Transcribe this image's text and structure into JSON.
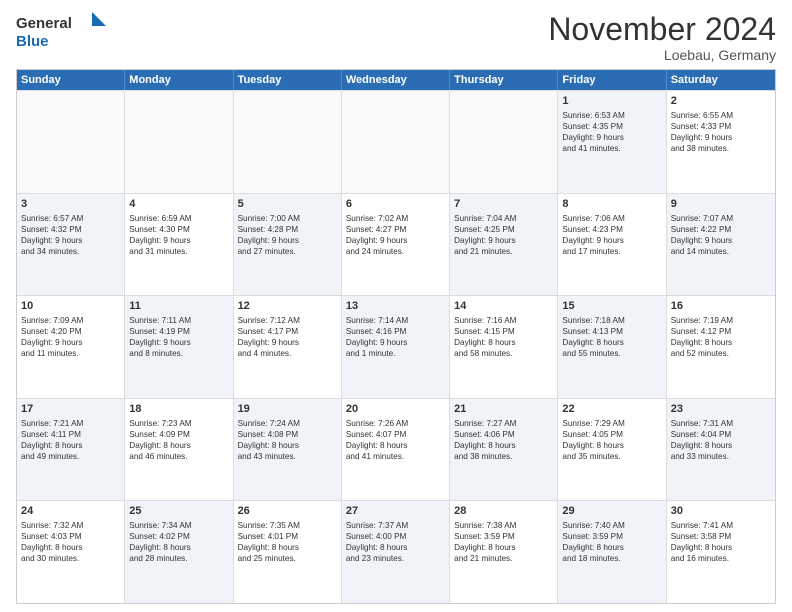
{
  "logo": {
    "line1": "General",
    "line2": "Blue"
  },
  "title": "November 2024",
  "subtitle": "Loebau, Germany",
  "header": {
    "days": [
      "Sunday",
      "Monday",
      "Tuesday",
      "Wednesday",
      "Thursday",
      "Friday",
      "Saturday"
    ]
  },
  "rows": [
    [
      {
        "day": "",
        "info": "",
        "empty": true
      },
      {
        "day": "",
        "info": "",
        "empty": true
      },
      {
        "day": "",
        "info": "",
        "empty": true
      },
      {
        "day": "",
        "info": "",
        "empty": true
      },
      {
        "day": "",
        "info": "",
        "empty": true
      },
      {
        "day": "1",
        "info": "Sunrise: 6:53 AM\nSunset: 4:35 PM\nDaylight: 9 hours\nand 41 minutes.",
        "shaded": true
      },
      {
        "day": "2",
        "info": "Sunrise: 6:55 AM\nSunset: 4:33 PM\nDaylight: 9 hours\nand 38 minutes.",
        "shaded": false
      }
    ],
    [
      {
        "day": "3",
        "info": "Sunrise: 6:57 AM\nSunset: 4:32 PM\nDaylight: 9 hours\nand 34 minutes.",
        "shaded": true
      },
      {
        "day": "4",
        "info": "Sunrise: 6:59 AM\nSunset: 4:30 PM\nDaylight: 9 hours\nand 31 minutes.",
        "shaded": false
      },
      {
        "day": "5",
        "info": "Sunrise: 7:00 AM\nSunset: 4:28 PM\nDaylight: 9 hours\nand 27 minutes.",
        "shaded": true
      },
      {
        "day": "6",
        "info": "Sunrise: 7:02 AM\nSunset: 4:27 PM\nDaylight: 9 hours\nand 24 minutes.",
        "shaded": false
      },
      {
        "day": "7",
        "info": "Sunrise: 7:04 AM\nSunset: 4:25 PM\nDaylight: 9 hours\nand 21 minutes.",
        "shaded": true
      },
      {
        "day": "8",
        "info": "Sunrise: 7:06 AM\nSunset: 4:23 PM\nDaylight: 9 hours\nand 17 minutes.",
        "shaded": false
      },
      {
        "day": "9",
        "info": "Sunrise: 7:07 AM\nSunset: 4:22 PM\nDaylight: 9 hours\nand 14 minutes.",
        "shaded": true
      }
    ],
    [
      {
        "day": "10",
        "info": "Sunrise: 7:09 AM\nSunset: 4:20 PM\nDaylight: 9 hours\nand 11 minutes.",
        "shaded": false
      },
      {
        "day": "11",
        "info": "Sunrise: 7:11 AM\nSunset: 4:19 PM\nDaylight: 9 hours\nand 8 minutes.",
        "shaded": true
      },
      {
        "day": "12",
        "info": "Sunrise: 7:12 AM\nSunset: 4:17 PM\nDaylight: 9 hours\nand 4 minutes.",
        "shaded": false
      },
      {
        "day": "13",
        "info": "Sunrise: 7:14 AM\nSunset: 4:16 PM\nDaylight: 9 hours\nand 1 minute.",
        "shaded": true
      },
      {
        "day": "14",
        "info": "Sunrise: 7:16 AM\nSunset: 4:15 PM\nDaylight: 8 hours\nand 58 minutes.",
        "shaded": false
      },
      {
        "day": "15",
        "info": "Sunrise: 7:18 AM\nSunset: 4:13 PM\nDaylight: 8 hours\nand 55 minutes.",
        "shaded": true
      },
      {
        "day": "16",
        "info": "Sunrise: 7:19 AM\nSunset: 4:12 PM\nDaylight: 8 hours\nand 52 minutes.",
        "shaded": false
      }
    ],
    [
      {
        "day": "17",
        "info": "Sunrise: 7:21 AM\nSunset: 4:11 PM\nDaylight: 8 hours\nand 49 minutes.",
        "shaded": true
      },
      {
        "day": "18",
        "info": "Sunrise: 7:23 AM\nSunset: 4:09 PM\nDaylight: 8 hours\nand 46 minutes.",
        "shaded": false
      },
      {
        "day": "19",
        "info": "Sunrise: 7:24 AM\nSunset: 4:08 PM\nDaylight: 8 hours\nand 43 minutes.",
        "shaded": true
      },
      {
        "day": "20",
        "info": "Sunrise: 7:26 AM\nSunset: 4:07 PM\nDaylight: 8 hours\nand 41 minutes.",
        "shaded": false
      },
      {
        "day": "21",
        "info": "Sunrise: 7:27 AM\nSunset: 4:06 PM\nDaylight: 8 hours\nand 38 minutes.",
        "shaded": true
      },
      {
        "day": "22",
        "info": "Sunrise: 7:29 AM\nSunset: 4:05 PM\nDaylight: 8 hours\nand 35 minutes.",
        "shaded": false
      },
      {
        "day": "23",
        "info": "Sunrise: 7:31 AM\nSunset: 4:04 PM\nDaylight: 8 hours\nand 33 minutes.",
        "shaded": true
      }
    ],
    [
      {
        "day": "24",
        "info": "Sunrise: 7:32 AM\nSunset: 4:03 PM\nDaylight: 8 hours\nand 30 minutes.",
        "shaded": false
      },
      {
        "day": "25",
        "info": "Sunrise: 7:34 AM\nSunset: 4:02 PM\nDaylight: 8 hours\nand 28 minutes.",
        "shaded": true
      },
      {
        "day": "26",
        "info": "Sunrise: 7:35 AM\nSunset: 4:01 PM\nDaylight: 8 hours\nand 25 minutes.",
        "shaded": false
      },
      {
        "day": "27",
        "info": "Sunrise: 7:37 AM\nSunset: 4:00 PM\nDaylight: 8 hours\nand 23 minutes.",
        "shaded": true
      },
      {
        "day": "28",
        "info": "Sunrise: 7:38 AM\nSunset: 3:59 PM\nDaylight: 8 hours\nand 21 minutes.",
        "shaded": false
      },
      {
        "day": "29",
        "info": "Sunrise: 7:40 AM\nSunset: 3:59 PM\nDaylight: 8 hours\nand 18 minutes.",
        "shaded": true
      },
      {
        "day": "30",
        "info": "Sunrise: 7:41 AM\nSunset: 3:58 PM\nDaylight: 8 hours\nand 16 minutes.",
        "shaded": false
      }
    ]
  ]
}
